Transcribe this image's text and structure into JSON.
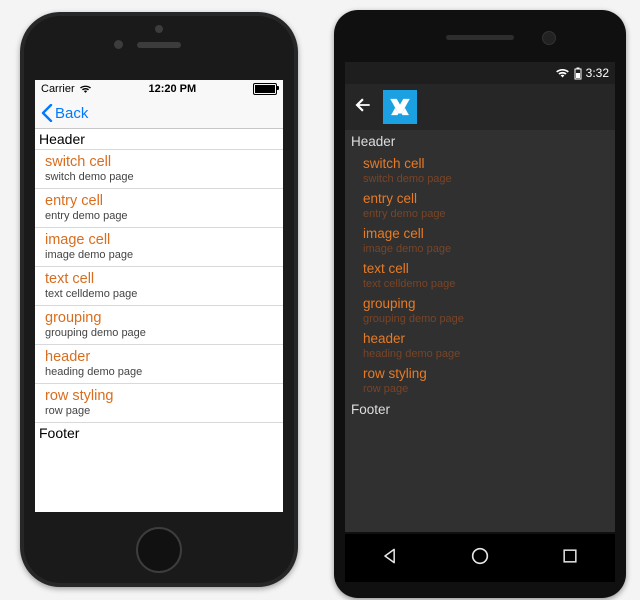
{
  "ios": {
    "status": {
      "carrier": "Carrier",
      "time": "12:20 PM"
    },
    "nav": {
      "back_label": "Back"
    },
    "list": {
      "header": "Header",
      "footer": "Footer",
      "items": [
        {
          "title": "switch cell",
          "detail": "switch demo page"
        },
        {
          "title": "entry cell",
          "detail": "entry demo page"
        },
        {
          "title": "image cell",
          "detail": "image demo page"
        },
        {
          "title": "text cell",
          "detail": "text celldemo page"
        },
        {
          "title": "grouping",
          "detail": "grouping demo page"
        },
        {
          "title": "header",
          "detail": "heading demo page"
        },
        {
          "title": "row styling",
          "detail": "row page"
        }
      ]
    }
  },
  "android": {
    "status": {
      "time": "3:32"
    },
    "list": {
      "header": "Header",
      "footer": "Footer",
      "items": [
        {
          "title": "switch cell",
          "detail": "switch demo page"
        },
        {
          "title": "entry cell",
          "detail": "entry demo page"
        },
        {
          "title": "image cell",
          "detail": "image demo page"
        },
        {
          "title": "text cell",
          "detail": "text celldemo page"
        },
        {
          "title": "grouping",
          "detail": "grouping demo page"
        },
        {
          "title": "header",
          "detail": "heading demo page"
        },
        {
          "title": "row styling",
          "detail": "row page"
        }
      ]
    }
  }
}
